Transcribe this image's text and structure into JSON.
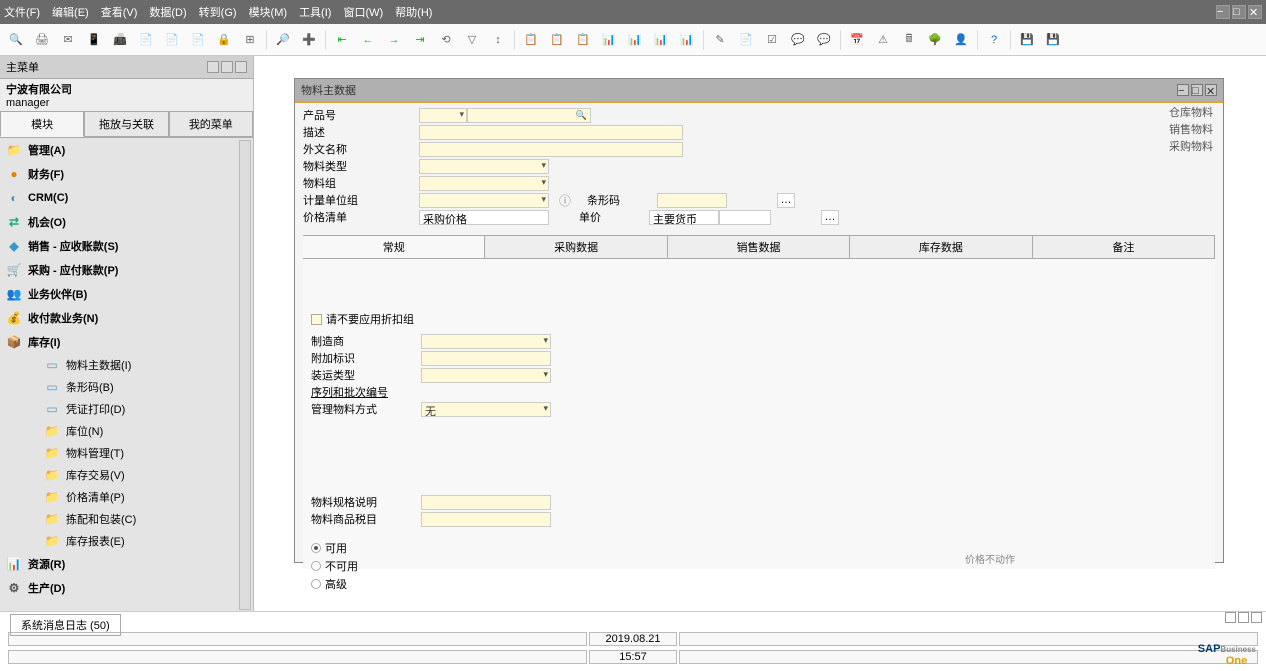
{
  "menubar": {
    "items": [
      "文件(F)",
      "编辑(E)",
      "查看(V)",
      "数据(D)",
      "转到(G)",
      "模块(M)",
      "工具(I)",
      "窗口(W)",
      "帮助(H)"
    ]
  },
  "sidebar": {
    "title": "主菜单",
    "company": "宁波有限公司",
    "role": "manager",
    "tabs": [
      "模块",
      "拖放与关联",
      "我的菜单"
    ],
    "modules": [
      {
        "label": "管理(A)"
      },
      {
        "label": "财务(F)"
      },
      {
        "label": "CRM(C)"
      },
      {
        "label": "机会(O)"
      },
      {
        "label": "销售 - 应收账款(S)"
      },
      {
        "label": "采购 - 应付账款(P)"
      },
      {
        "label": "业务伙伴(B)"
      },
      {
        "label": "收付款业务(N)"
      },
      {
        "label": "库存(I)"
      }
    ],
    "inventory_children": [
      {
        "label": "物料主数据(I)"
      },
      {
        "label": "条形码(B)"
      },
      {
        "label": "凭证打印(D)"
      },
      {
        "label": "库位(N)"
      },
      {
        "label": "物料管理(T)"
      },
      {
        "label": "库存交易(V)"
      },
      {
        "label": "价格清单(P)"
      },
      {
        "label": "拣配和包装(C)"
      },
      {
        "label": "库存报表(E)"
      }
    ],
    "modules_after": [
      {
        "label": "资源(R)"
      },
      {
        "label": "生产(D)"
      }
    ]
  },
  "form": {
    "title": "物料主数据",
    "fields": {
      "product_no": "产品号",
      "description": "描述",
      "foreign_name": "外文名称",
      "item_type": "物料类型",
      "item_group": "物料组",
      "uom_group": "计量单位组",
      "price_list": "价格清单",
      "price_list_value": "采购价格",
      "barcode": "条形码",
      "unit_price": "单价",
      "main_currency": "主要货币"
    },
    "side_links": [
      "仓库物料",
      "销售物料",
      "采购物料"
    ],
    "tabs": [
      "常规",
      "采购数据",
      "销售数据",
      "库存数据",
      "备注"
    ],
    "general": {
      "no_discount": "请不要应用折扣组",
      "manufacturer": "制造商",
      "addl_ident": "附加标识",
      "ship_type": "装运类型",
      "serial_batch": "序列和批次编号",
      "manage_method": "管理物料方式",
      "manage_method_value": "无",
      "spec_desc": "物料规格说明",
      "commodity_tax": "物料商品税目",
      "radio_available": "可用",
      "radio_unavailable": "不可用",
      "radio_advanced": "高级"
    },
    "bottom_hint": "价格不动作"
  },
  "bottom": {
    "msg_log": "系统消息日志 (50)",
    "date": "2019.08.21",
    "time": "15:57",
    "logo_main": "SAP",
    "logo_sub": "Business",
    "logo_one": "One"
  }
}
